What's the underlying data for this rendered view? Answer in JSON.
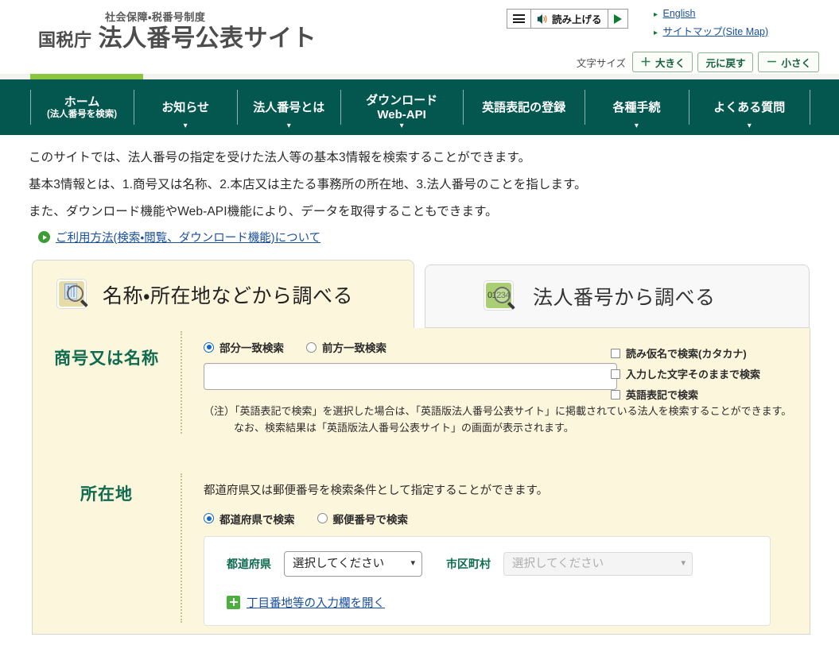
{
  "header": {
    "brand_sub": "社会保障・税番号制度",
    "brand_agency": "国税庁",
    "brand_title": "法人番号公表サイト",
    "speech": {
      "menu_icon": "hamburger-icon",
      "speaker_icon": "speaker-icon",
      "label": "読み上げる",
      "play_icon": "play-icon"
    },
    "links": [
      {
        "label": "English"
      },
      {
        "label": "サイトマップ(Site Map)"
      }
    ],
    "fontsize": {
      "label": "文字サイズ",
      "larger": {
        "sign": "＋",
        "label": "大きく"
      },
      "reset": {
        "sign": "",
        "label": "元に戻す"
      },
      "smaller": {
        "sign": "－",
        "label": "小さく"
      }
    }
  },
  "nav": {
    "active_index": 0,
    "items": [
      {
        "label": "ホーム",
        "sub": "(法人番号を検索)",
        "caret": false
      },
      {
        "label": "お知らせ",
        "sub": "",
        "caret": true
      },
      {
        "label": "法人番号とは",
        "sub": "",
        "caret": true
      },
      {
        "label": "ダウンロード",
        "sub": "Web-API",
        "caret": true
      },
      {
        "label": "英語表記の登録",
        "sub": "",
        "caret": false
      },
      {
        "label": "各種手続",
        "sub": "",
        "caret": true
      },
      {
        "label": "よくある質問",
        "sub": "",
        "caret": true
      }
    ]
  },
  "intro": {
    "lines": [
      "このサイトでは、法人番号の指定を受けた法人等の基本3情報を検索することができます。",
      "基本3情報とは、1.商号又は名称、2.本店又は主たる事務所の所在地、3.法人番号のことを指します。",
      "また、ダウンロード機能やWeb-API機能により、データを取得することもできます。"
    ],
    "link": "ご利用方法(検索・閲覧、ダウンロード機能)について"
  },
  "tabs": [
    {
      "title": "名称・所在地などから調べる",
      "icon": "building-search-icon",
      "active": true
    },
    {
      "title": "法人番号から調べる",
      "icon": "number-search-icon",
      "icon_text": "01234",
      "active": false
    }
  ],
  "form": {
    "name_section": {
      "label": "商号又は名称",
      "radios": [
        {
          "label": "部分一致検索",
          "checked": true
        },
        {
          "label": "前方一致検索",
          "checked": false
        }
      ],
      "input_value": "",
      "input_placeholder": "",
      "checkboxes": [
        {
          "label": "読み仮名で検索(カタカナ)",
          "checked": false
        },
        {
          "label": "入力した文字そのままで検索",
          "checked": false
        },
        {
          "label": "英語表記で検索",
          "checked": false
        }
      ],
      "note_line1": "（注）「英語表記で検索」を選択した場合は、「英語版法人番号公表サイト」に掲載されている法人を検索することができます。",
      "note_line2": "なお、検索結果は「英語版法人番号公表サイト」の画面が表示されます。"
    },
    "location_section": {
      "label": "所在地",
      "description": "都道府県又は郵便番号を検索条件として指定することができます。",
      "radios": [
        {
          "label": "都道府県で検索",
          "checked": true
        },
        {
          "label": "郵便番号で検索",
          "checked": false
        }
      ],
      "prefecture_label": "都道府県",
      "prefecture_value": "選択してください",
      "city_label": "市区町村",
      "city_value": "選択してください",
      "expand_link": "丁目番地等の入力欄を開く"
    }
  },
  "colors": {
    "nav_bg": "#03574f",
    "nav_active_bar": "#8cc63e",
    "panel_bg": "#fcf6dc",
    "label_green": "#0e6b4f",
    "link_blue": "#1a4f9c"
  }
}
